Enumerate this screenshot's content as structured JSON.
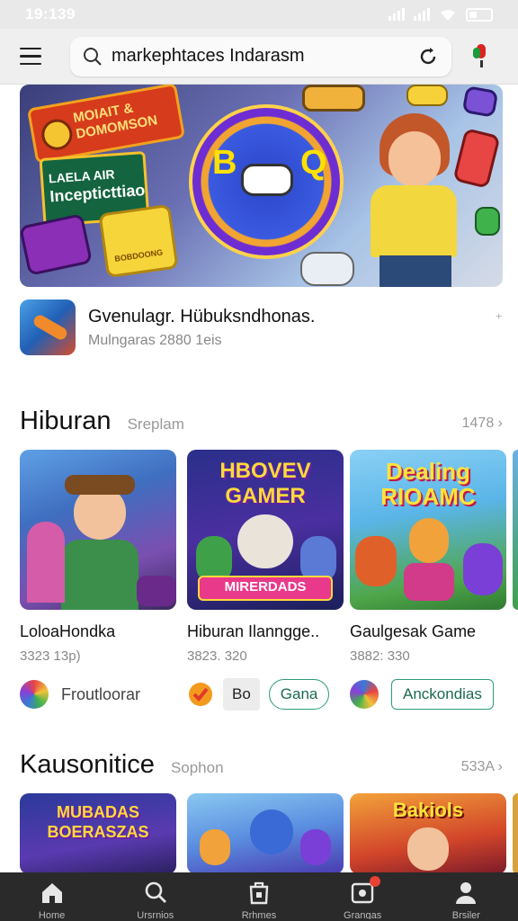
{
  "status_bar": {
    "time": "19:139"
  },
  "search": {
    "value": "markephtaces Indarasm"
  },
  "featured": {
    "badge_text": "MOIAIT & DOMOMSON",
    "sign_small": "LAELA AIR",
    "sign_big": "Incepticttiao",
    "cube_text": "BOBDOONG",
    "app_title": "Gvenulagr. Hübuksndhonas.",
    "app_meta": "Mulngaras 2880 1eis",
    "more_glyph": "⁺"
  },
  "sections": [
    {
      "title": "Hiburan",
      "subtitle": "Sreplam",
      "link": "1478 ›",
      "cards": [
        {
          "title": "LoloaHondka",
          "meta": "3323 13p)",
          "action_label": "Froutloorar"
        },
        {
          "title": "Hiburan Ilanngge..",
          "meta": "3823. 320",
          "thumb_top": "HBOVEV GAMER",
          "thumb_bottom": "MIRERDADS",
          "action_grey": "Bo",
          "action_pill": "Gana"
        },
        {
          "title": "Gaulgesak Game",
          "meta": "3882: 330",
          "thumb_top": "Dealing RIOAMC",
          "action_pill": "Anckondias"
        }
      ]
    },
    {
      "title": "Kausonitice",
      "subtitle": "Sophon",
      "link": "533A ›",
      "cards": [
        {
          "thumb_top": "MUBADAS BOERASZAS"
        },
        {
          "thumb_top": ""
        },
        {
          "thumb_top": "Bakiols"
        }
      ]
    }
  ],
  "bottom_nav": [
    {
      "label": "Home",
      "icon": "home-icon"
    },
    {
      "label": "Ursrnios",
      "icon": "search-icon"
    },
    {
      "label": "Rrhmes",
      "icon": "bag-icon"
    },
    {
      "label": "Grangas",
      "icon": "games-icon",
      "badge": true
    },
    {
      "label": "Brsiler",
      "icon": "profile-icon"
    }
  ],
  "colors": {
    "accent": "#2e9c73",
    "nav_bg": "#2a2a2a",
    "badge": "#e74234"
  }
}
